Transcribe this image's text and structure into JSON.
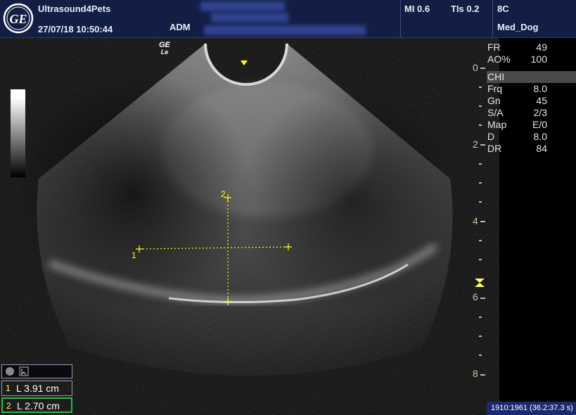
{
  "header": {
    "site_name": "Ultrasound4Pets",
    "datetime": "27/07/18 10:50:44",
    "operator": "ADM",
    "mi": "MI 0.6",
    "tis": "TIs 0.2",
    "probe": "8C",
    "preset": "Med_Dog"
  },
  "params": {
    "fr_label": "FR",
    "fr_value": "49",
    "ao_label": "AO%",
    "ao_value": "100",
    "mode": "CHI",
    "rows": [
      {
        "k": "Frq",
        "v": "8.0"
      },
      {
        "k": "Gn",
        "v": "45"
      },
      {
        "k": "S/A",
        "v": "2/3"
      },
      {
        "k": "Map",
        "v": "E/0"
      },
      {
        "k": "D",
        "v": "8.0"
      },
      {
        "k": "DR",
        "v": "84"
      }
    ]
  },
  "depth_scale": {
    "labels": [
      "0",
      "2",
      "4",
      "6",
      "8"
    ]
  },
  "probe_mark": {
    "line1": "GE",
    "line2": "Le"
  },
  "measurements": [
    {
      "index": "1",
      "text": "L  3.91 cm",
      "color": "#e0e0e0"
    },
    {
      "index": "2",
      "text": "L  2.70 cm",
      "color": "#1fbf3f"
    }
  ],
  "calipers": {
    "label1": "1",
    "label2": "2",
    "color": "#ffff00"
  },
  "frame_counter": "1910:1961  (36.2:37.3 s)",
  "colors": {
    "header_bg": "#131e45",
    "caliper": "#ffff00",
    "scale": "#c9c7a4"
  }
}
